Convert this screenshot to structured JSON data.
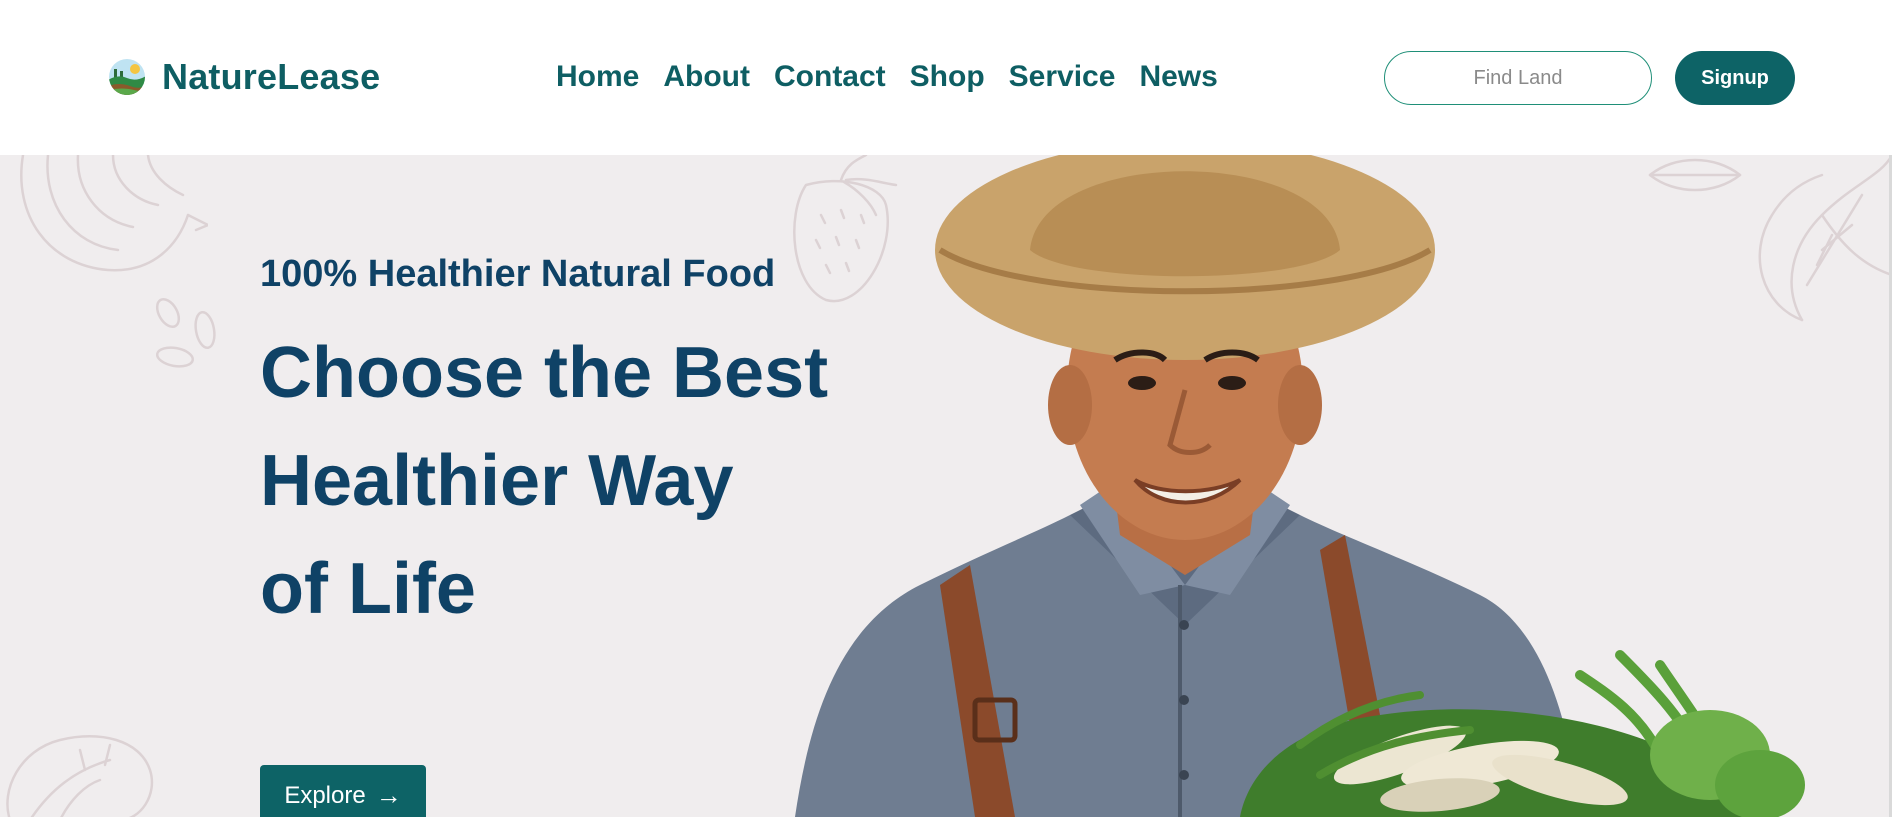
{
  "brand": {
    "name": "NatureLease",
    "logo_icon": "landscape-logo-icon"
  },
  "nav": {
    "links": [
      "Home",
      "About",
      "Contact",
      "Shop",
      "Service",
      "News"
    ]
  },
  "search": {
    "placeholder": "Find Land",
    "value": ""
  },
  "signup": {
    "label": "Signup"
  },
  "hero": {
    "eyebrow": "100% Healthier Natural Food",
    "heading_lines": [
      "Choose the Best",
      "Healthier Way",
      "of Life"
    ],
    "cta_label": "Explore",
    "cta_icon": "arrow-right-icon",
    "cta_arrow": "→",
    "image": "farmer-with-vegetables-photo"
  },
  "colors": {
    "brand_teal": "#0e5e63",
    "button_teal": "#0d6366",
    "heading_navy": "#0f4266",
    "hero_background": "#f0edee",
    "search_border": "#1f8f78"
  }
}
